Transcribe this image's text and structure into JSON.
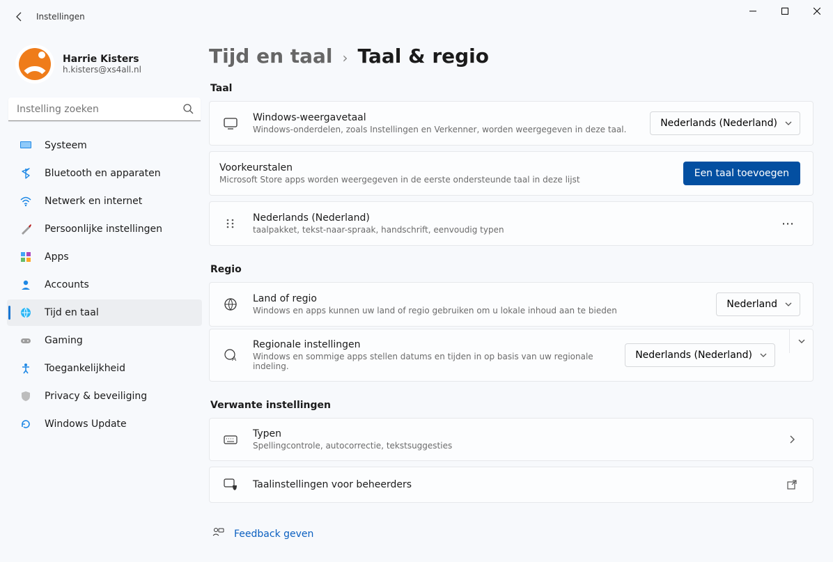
{
  "window": {
    "title": "Instellingen"
  },
  "user": {
    "name": "Harrie Kisters",
    "email": "h.kisters@xs4all.nl"
  },
  "search": {
    "placeholder": "Instelling zoeken"
  },
  "nav": {
    "system": "Systeem",
    "bluetooth": "Bluetooth en apparaten",
    "network": "Netwerk en internet",
    "personalization": "Persoonlijke instellingen",
    "apps": "Apps",
    "accounts": "Accounts",
    "time": "Tijd en taal",
    "gaming": "Gaming",
    "accessibility": "Toegankelijkheid",
    "privacy": "Privacy & beveiliging",
    "update": "Windows Update"
  },
  "breadcrumb": {
    "parent": "Tijd en taal",
    "current": "Taal & regio"
  },
  "sections": {
    "lang_header": "Taal",
    "region_header": "Regio",
    "related_header": "Verwante instellingen"
  },
  "display_lang": {
    "title": "Windows-weergavetaal",
    "sub": "Windows-onderdelen, zoals Instellingen en Verkenner, worden weergegeven in deze taal.",
    "value": "Nederlands (Nederland)"
  },
  "preferred": {
    "title": "Voorkeurstalen",
    "sub": "Microsoft Store apps worden weergegeven in de eerste ondersteunde taal in deze lijst",
    "add_btn": "Een taal toevoegen"
  },
  "lang_item": {
    "title": "Nederlands (Nederland)",
    "sub": "taalpakket, tekst-naar-spraak, handschrift, eenvoudig typen"
  },
  "country": {
    "title": "Land of regio",
    "sub": "Windows en apps kunnen uw land of regio gebruiken om u lokale inhoud aan te bieden",
    "value": "Nederland"
  },
  "regional": {
    "title": "Regionale instellingen",
    "sub": "Windows en sommige apps stellen datums en tijden in op basis van uw regionale indeling.",
    "value": "Nederlands (Nederland)"
  },
  "typing": {
    "title": "Typen",
    "sub": "Spellingcontrole, autocorrectie, tekstsuggesties"
  },
  "admin_lang": {
    "title": "Taalinstellingen voor beheerders"
  },
  "feedback": {
    "label": "Feedback geven"
  }
}
